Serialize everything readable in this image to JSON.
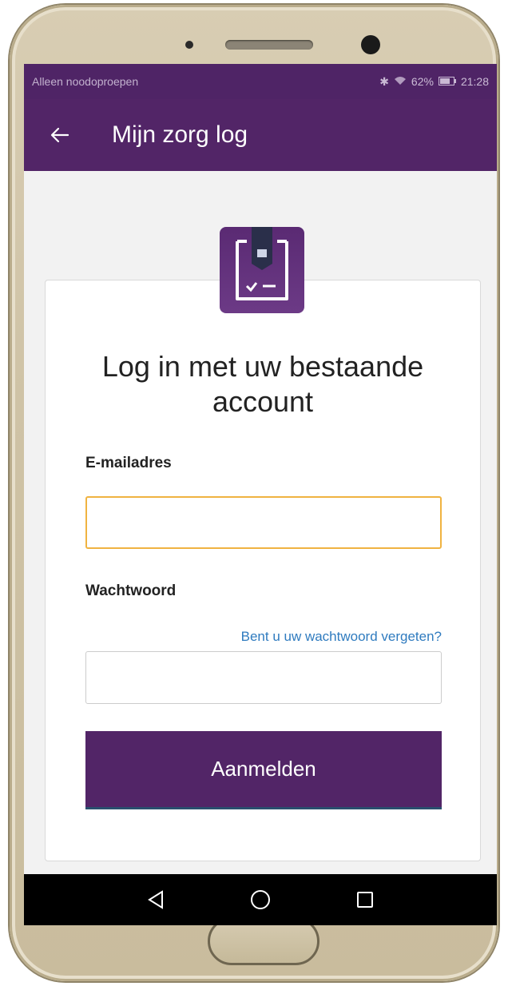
{
  "statusbar": {
    "left_text": "Alleen noodoproepen",
    "battery": "62%",
    "time": "21:28"
  },
  "appbar": {
    "title": "Mijn zorg log",
    "back_icon": "arrow-left-icon"
  },
  "login": {
    "heading": "Log in met uw bestaande account",
    "email_label": "E-mailadres",
    "email_value": "",
    "password_label": "Wachtwoord",
    "password_value": "",
    "forgot_link": "Bent u uw wachtwoord vergeten?",
    "submit_label": "Aanmelden"
  },
  "colors": {
    "brand": "#522567",
    "focus_border": "#f0b341",
    "link": "#2f7bbf"
  },
  "navbar": {
    "back_icon": "triangle-back-icon",
    "home_icon": "circle-home-icon",
    "recents_icon": "square-recents-icon"
  }
}
